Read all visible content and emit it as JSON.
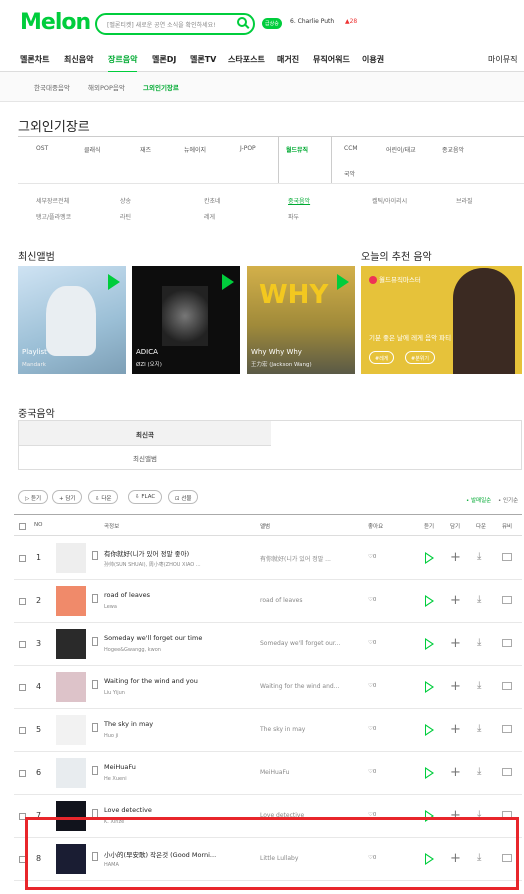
{
  "brand": {
    "logo": "Melon"
  },
  "search": {
    "placeholder": "[멜론티켓] 새로운 공연 소식을 확인하세요!",
    "rank_badge": "급상승",
    "keyword": "6. Charlie Puth",
    "change": "▲28"
  },
  "gnb": [
    {
      "label": "멜론차트"
    },
    {
      "label": "최신음악"
    },
    {
      "label": "장르음악"
    },
    {
      "label": "멜론DJ"
    },
    {
      "label": "멜론TV"
    },
    {
      "label": "스타포스트"
    },
    {
      "label": "매거진"
    },
    {
      "label": "뮤직어워드"
    },
    {
      "label": "이용권"
    },
    {
      "label": "마이뮤직"
    }
  ],
  "subnav": [
    {
      "label": "한국대중음악"
    },
    {
      "label": "해외POP음악"
    },
    {
      "label": "그외인기장르"
    }
  ],
  "page_title": "그외인기장르",
  "genres": [
    {
      "label": "OST"
    },
    {
      "label": "클래식"
    },
    {
      "label": "재즈"
    },
    {
      "label": "뉴에이지"
    },
    {
      "label": "J-POP"
    },
    {
      "label": "월드뮤직"
    },
    {
      "label": "CCM"
    },
    {
      "label": "어린이/태교"
    },
    {
      "label": "종교음악"
    },
    {
      "label": "국악"
    }
  ],
  "subgenres": [
    {
      "label": "세부장르전체"
    },
    {
      "label": "샹송"
    },
    {
      "label": "칸초네"
    },
    {
      "label": "중국음악"
    },
    {
      "label": "켈틱/아이리시"
    },
    {
      "label": "브라질"
    },
    {
      "label": "탱고/플라멩코"
    },
    {
      "label": "라틴"
    },
    {
      "label": "레게"
    },
    {
      "label": "파두"
    }
  ],
  "latest_albums": {
    "title": "최신앨범",
    "items": [
      {
        "name": "Playlist",
        "artist": "Mandark"
      },
      {
        "name": "ADICA",
        "artist": "ØZI (오지)"
      },
      {
        "name": "Why Why Why",
        "artist": "王力宏 (Jackson Wang)"
      }
    ]
  },
  "recommend": {
    "title": "오늘의 추천 음악",
    "dj": "월드뮤직마스터",
    "desc": "기분 좋은 날에 레게 음악 파티",
    "tags": [
      "#레게",
      "#분위기"
    ]
  },
  "section_title": "중국음악",
  "tabs": [
    {
      "label": "최신곡"
    },
    {
      "label": "최신앨범"
    }
  ],
  "actions": [
    {
      "label": "듣기"
    },
    {
      "label": "담기"
    },
    {
      "label": "다운"
    },
    {
      "label": "FLAC"
    },
    {
      "label": "선물"
    }
  ],
  "sort": [
    {
      "label": "발매일순"
    },
    {
      "label": "인기순"
    }
  ],
  "table_headers": {
    "no": "NO",
    "song": "곡정보",
    "album": "앨범",
    "like": "좋아요",
    "listen": "듣기",
    "add": "담기",
    "download": "다운",
    "mv": "뮤비"
  },
  "rows": [
    {
      "no": "1",
      "song": "有你就好(니가 있어 정말 좋아)",
      "artist": "孙帅(SUN SHUAI), 周小枣(ZHOU XIAO ...",
      "album": "有你就好(니가 있어 정말 ...",
      "likes": "♡0"
    },
    {
      "no": "2",
      "song": "road of leaves",
      "artist": "Lewa",
      "album": "road of leaves",
      "likes": "♡0"
    },
    {
      "no": "3",
      "song": "Someday we'll forget our time",
      "artist": "Hogee&Gwangg, kwon",
      "album": "Someday we'll forget our...",
      "likes": "♡0"
    },
    {
      "no": "4",
      "song": "Waiting for the wind and you",
      "artist": "Liu Yijun",
      "album": "Waiting for the wind and...",
      "likes": "♡0"
    },
    {
      "no": "5",
      "song": "The sky in may",
      "artist": "Huo ji",
      "album": "The sky in may",
      "likes": "♡0"
    },
    {
      "no": "6",
      "song": "MeiHuaFu",
      "artist": "He Xueni",
      "album": "MeiHuaFu",
      "likes": "♡0"
    },
    {
      "no": "7",
      "song": "Love detective",
      "artist": "K. Xinze",
      "album": "Love detective",
      "likes": "♡0"
    },
    {
      "no": "8",
      "song": "小小的(早安歌) 작은것 (Good Morni...",
      "artist": "HAMA",
      "album": "Little Lullaby",
      "likes": "♡0"
    }
  ],
  "colors": {
    "accent": "#00cd3c",
    "highlight": "#e8262b"
  }
}
